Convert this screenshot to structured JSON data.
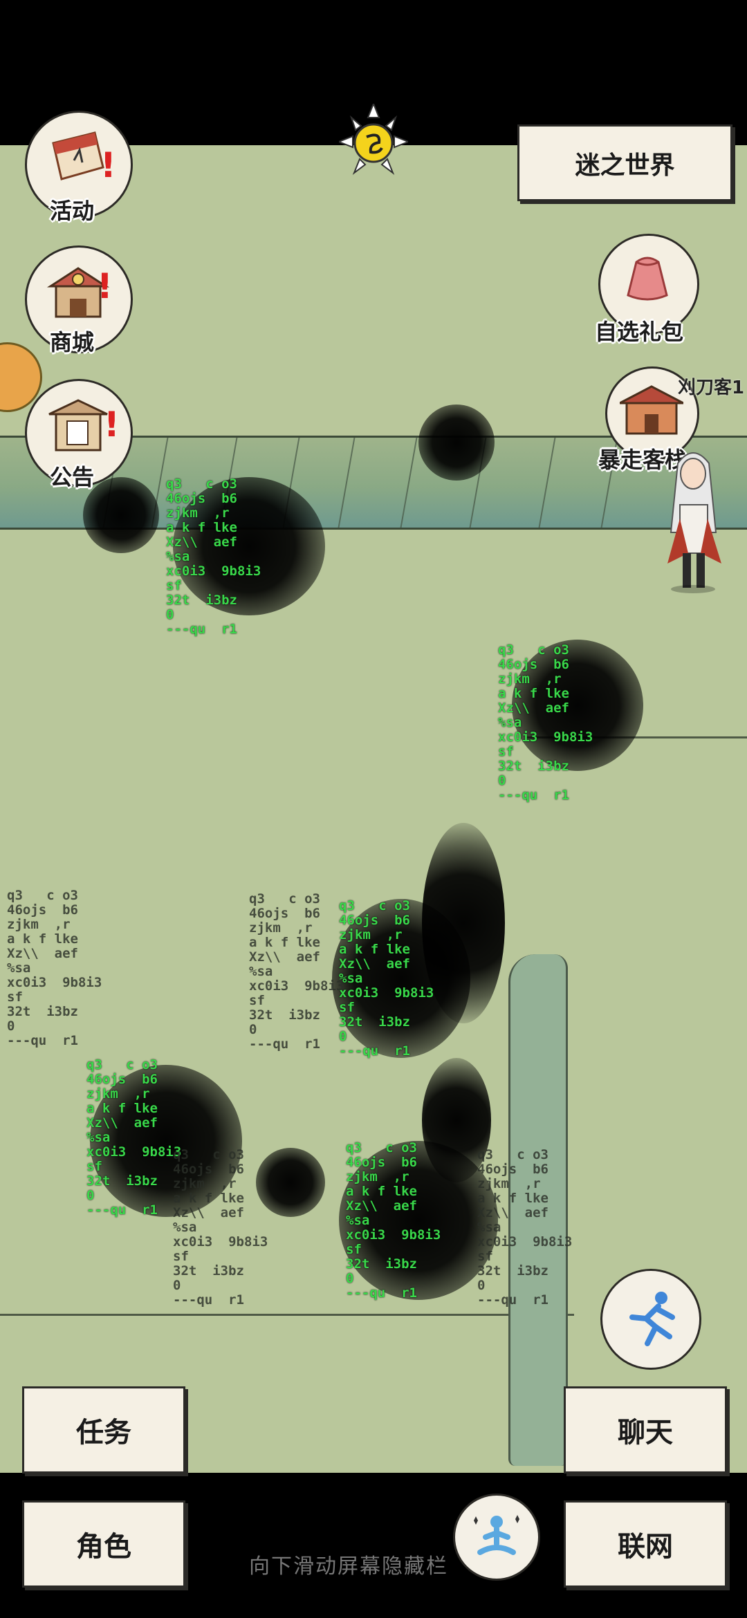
{
  "top_bar": {
    "world_button": "迷之世界",
    "sun_icon": "sun-icon"
  },
  "left_menu": [
    {
      "label": "活动",
      "icon": "scroll-icon",
      "badge": "!"
    },
    {
      "label": "商城",
      "icon": "shop-icon",
      "badge": "!"
    },
    {
      "label": "公告",
      "icon": "notice-board-icon",
      "badge": "!"
    }
  ],
  "right_menu": [
    {
      "label": "自选礼包",
      "icon": "gift-bag-icon"
    },
    {
      "label": "暴走客栈",
      "icon": "inn-icon"
    }
  ],
  "player_nameplate": "刈刀客1",
  "bottom_buttons": {
    "task": "任务",
    "chat": "聊天",
    "role": "角色",
    "network": "联网"
  },
  "run_button_icon": "run-icon",
  "meditate_button_icon": "meditate-icon",
  "hint_text": "向下滑动屏幕隐藏栏",
  "glitch_text": "q3   c o3\n46ojs  b6\nzjkm  ,r\na k f lke\nXz\\\\  aef\n%sa\nxc0i3  9b8i3\nsf\n32t  i3bz\n0\n---qu  r1",
  "colors": {
    "map_bg": "#b9c79b",
    "glitch_green": "#39d84a",
    "alert_red": "#dd2222"
  }
}
